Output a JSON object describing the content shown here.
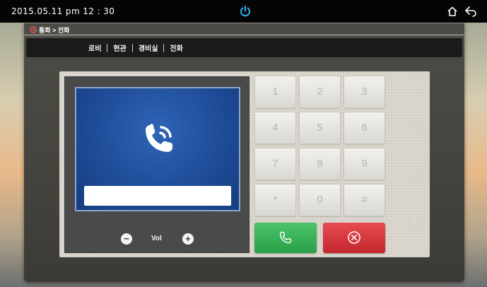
{
  "status_bar": {
    "datetime": "2015.05.11  pm 12 : 30",
    "icons": [
      "power-icon",
      "home-icon",
      "back-icon"
    ]
  },
  "breadcrumb": {
    "icon": "location-pin-icon",
    "text": "통화 > 전화"
  },
  "tabs": [
    {
      "label": "로비"
    },
    {
      "label": "현관"
    },
    {
      "label": "경비실"
    },
    {
      "label": "전화"
    }
  ],
  "display": {
    "icon": "phone-call-icon",
    "number_value": ""
  },
  "volume": {
    "label": "Vol",
    "minus": "−",
    "plus": "+"
  },
  "keypad": {
    "keys": [
      "1",
      "2",
      "3",
      "4",
      "5",
      "6",
      "7",
      "8",
      "9",
      "*",
      "0",
      "#"
    ]
  },
  "actions": {
    "call_icon": "phone-icon",
    "hangup_icon": "close-circle-icon"
  },
  "colors": {
    "call": "#34b356",
    "hangup": "#d8353c",
    "screen": "#1e4c98"
  }
}
